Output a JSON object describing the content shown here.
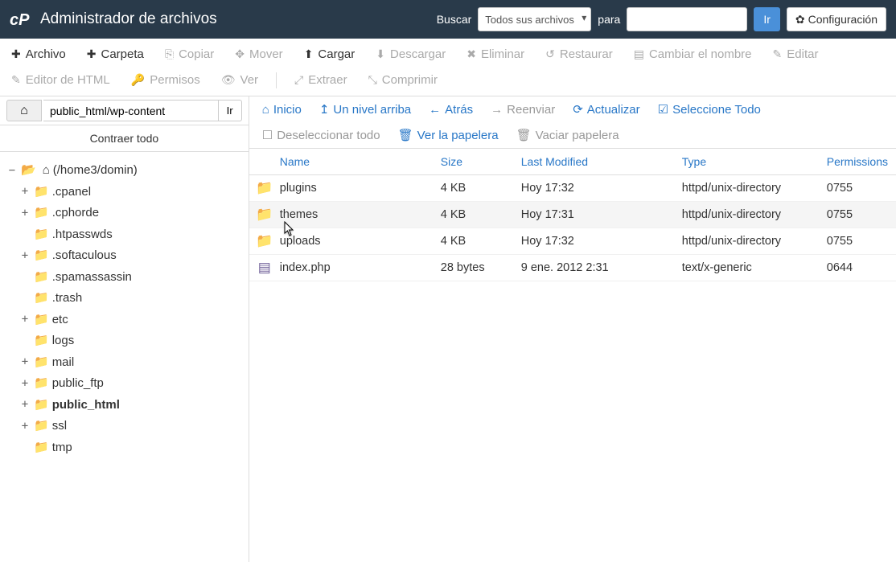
{
  "header": {
    "title": "Administrador de archivos",
    "search_label": "Buscar",
    "scope_selected": "Todos sus archivos",
    "for_label": "para",
    "go_label": "Ir",
    "config_label": "Configuración"
  },
  "toolbar": {
    "file": "Archivo",
    "folder": "Carpeta",
    "copy": "Copiar",
    "move": "Mover",
    "upload": "Cargar",
    "download": "Descargar",
    "delete": "Eliminar",
    "restore": "Restaurar",
    "rename": "Cambiar el nombre",
    "edit": "Editar",
    "html_editor": "Editor de HTML",
    "permissions": "Permisos",
    "view": "Ver",
    "extract": "Extraer",
    "compress": "Comprimir"
  },
  "sidebar": {
    "path_value": "public_html/wp-content",
    "go_label": "Ir",
    "collapse_all": "Contraer todo",
    "tree": {
      "root_label": "(/home3/domin)",
      "nodes": [
        {
          "label": ".cpanel",
          "expandable": true
        },
        {
          "label": ".cphorde",
          "expandable": true
        },
        {
          "label": ".htpasswds",
          "expandable": false
        },
        {
          "label": ".softaculous",
          "expandable": true
        },
        {
          "label": ".spamassassin",
          "expandable": false
        },
        {
          "label": ".trash",
          "expandable": false
        },
        {
          "label": "etc",
          "expandable": true
        },
        {
          "label": "logs",
          "expandable": false
        },
        {
          "label": "mail",
          "expandable": true
        },
        {
          "label": "public_ftp",
          "expandable": true
        },
        {
          "label": "public_html",
          "expandable": true,
          "bold": true
        },
        {
          "label": "ssl",
          "expandable": true
        },
        {
          "label": "tmp",
          "expandable": false
        }
      ]
    }
  },
  "actions": {
    "home": "Inicio",
    "up": "Un nivel arriba",
    "back": "Atrás",
    "forward": "Reenviar",
    "reload": "Actualizar",
    "select_all": "Seleccione Todo",
    "deselect_all": "Deseleccionar todo",
    "view_trash": "Ver la papelera",
    "empty_trash": "Vaciar papelera"
  },
  "table": {
    "headers": {
      "name": "Name",
      "size": "Size",
      "modified": "Last Modified",
      "type": "Type",
      "permissions": "Permissions"
    },
    "rows": [
      {
        "icon": "folder",
        "name": "plugins",
        "size": "4 KB",
        "modified": "Hoy 17:32",
        "type": "httpd/unix-directory",
        "perm": "0755"
      },
      {
        "icon": "folder",
        "name": "themes",
        "size": "4 KB",
        "modified": "Hoy 17:31",
        "type": "httpd/unix-directory",
        "perm": "0755",
        "hover": true
      },
      {
        "icon": "folder",
        "name": "uploads",
        "size": "4 KB",
        "modified": "Hoy 17:32",
        "type": "httpd/unix-directory",
        "perm": "0755"
      },
      {
        "icon": "doc",
        "name": "index.php",
        "size": "28 bytes",
        "modified": "9 ene. 2012 2:31",
        "type": "text/x-generic",
        "perm": "0644"
      }
    ]
  }
}
